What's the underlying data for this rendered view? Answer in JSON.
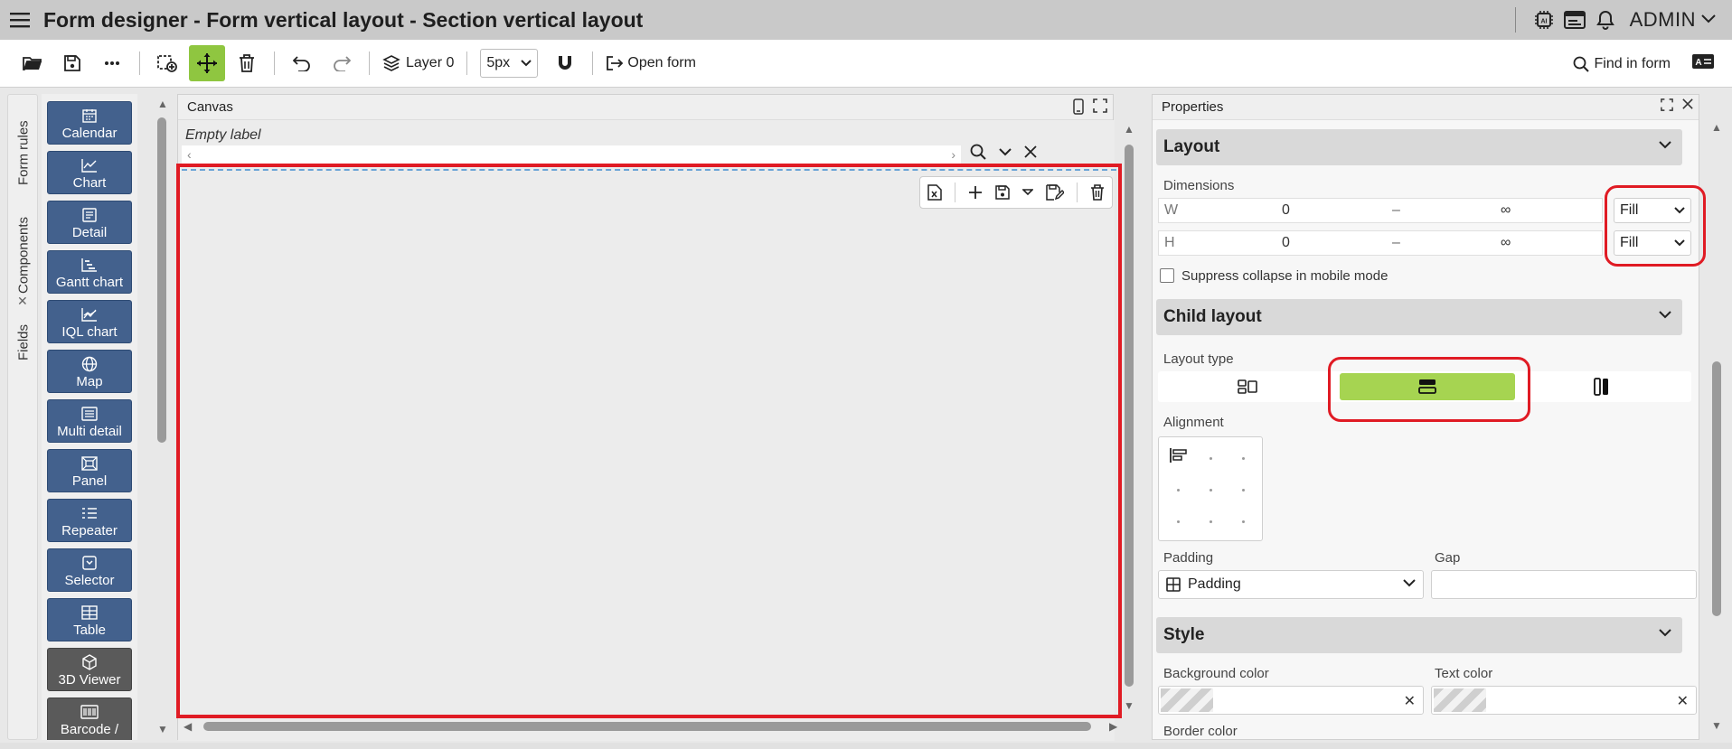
{
  "titlebar": {
    "title": "Form designer - Form vertical layout - Section vertical layout",
    "user": "ADMIN"
  },
  "toolbar": {
    "layer_label": "Layer 0",
    "grid_size": "5px",
    "open_form_label": "Open form",
    "find_label": "Find in form"
  },
  "side_tabs": {
    "form_rules": "Form rules",
    "components": "Components",
    "fields": "Fields"
  },
  "palette": {
    "items": [
      {
        "label": "Calendar"
      },
      {
        "label": "Chart"
      },
      {
        "label": "Detail"
      },
      {
        "label": "Gantt chart"
      },
      {
        "label": "IQL chart"
      },
      {
        "label": "Map"
      },
      {
        "label": "Multi detail"
      },
      {
        "label": "Panel"
      },
      {
        "label": "Repeater"
      },
      {
        "label": "Selector"
      },
      {
        "label": "Table"
      },
      {
        "label": "3D Viewer"
      },
      {
        "label": "Barcode /"
      }
    ]
  },
  "canvas": {
    "title": "Canvas",
    "empty_label": "Empty label"
  },
  "properties": {
    "title": "Properties",
    "layout_section": "Layout",
    "dimensions_label": "Dimensions",
    "width": {
      "label": "W",
      "min": "0",
      "sep": "–",
      "max": "∞",
      "mode": "Fill"
    },
    "height": {
      "label": "H",
      "min": "0",
      "sep": "–",
      "max": "∞",
      "mode": "Fill"
    },
    "suppress_collapse": "Suppress collapse in mobile mode",
    "child_layout_section": "Child layout",
    "layout_type_label": "Layout type",
    "alignment_label": "Alignment",
    "padding_label": "Padding",
    "padding_value": "Padding",
    "gap_label": "Gap",
    "style_section": "Style",
    "bg_color_label": "Background color",
    "text_color_label": "Text color",
    "border_color_label": "Border color"
  },
  "colors": {
    "accent_green": "#8fc640",
    "palette_blue": "#43618d",
    "highlight_red": "#e01b24"
  }
}
